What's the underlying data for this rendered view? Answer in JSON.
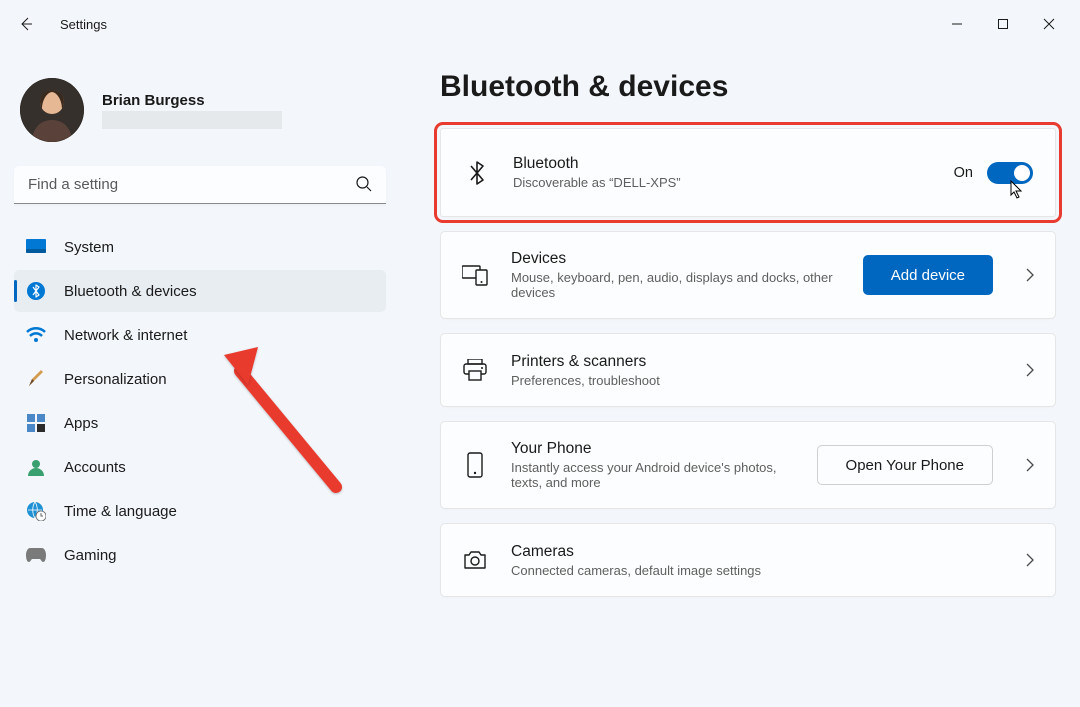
{
  "app": {
    "title": "Settings"
  },
  "window": {
    "minimize": "—",
    "maximize": "▢",
    "close": "✕"
  },
  "user": {
    "name": "Brian Burgess"
  },
  "search": {
    "placeholder": "Find a setting"
  },
  "nav": {
    "system": "System",
    "bluetooth": "Bluetooth & devices",
    "network": "Network & internet",
    "personalization": "Personalization",
    "apps": "Apps",
    "accounts": "Accounts",
    "time": "Time & language",
    "gaming": "Gaming"
  },
  "page": {
    "title": "Bluetooth & devices"
  },
  "cards": {
    "bt": {
      "title": "Bluetooth",
      "sub": "Discoverable as “DELL-XPS”",
      "toggle_label": "On"
    },
    "devices": {
      "title": "Devices",
      "sub": "Mouse, keyboard, pen, audio, displays and docks, other devices",
      "button": "Add device"
    },
    "printers": {
      "title": "Printers & scanners",
      "sub": "Preferences, troubleshoot"
    },
    "phone": {
      "title": "Your Phone",
      "sub": "Instantly access your Android device's photos, texts, and more",
      "button": "Open Your Phone"
    },
    "cameras": {
      "title": "Cameras",
      "sub": "Connected cameras, default image settings"
    }
  }
}
